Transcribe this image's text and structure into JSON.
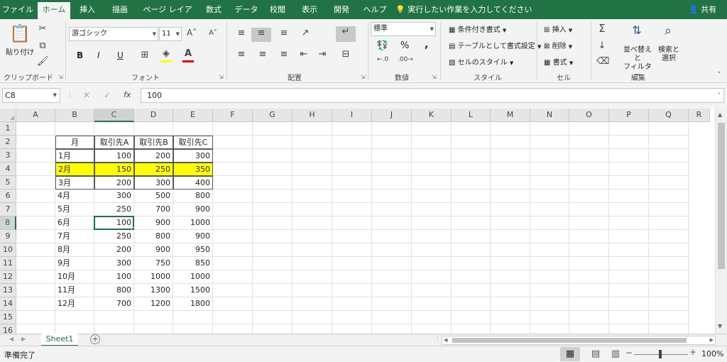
{
  "menu": {
    "tabs": [
      "ファイル",
      "ホーム",
      "挿入",
      "描画",
      "ページ レイアウト",
      "数式",
      "データ",
      "校閲",
      "表示",
      "開発",
      "ヘルプ"
    ],
    "active_tab": "ホーム",
    "tell_me": "実行したい作業を入力してください",
    "share": "共有"
  },
  "ribbon": {
    "clipboard": {
      "paste": "貼り付け",
      "label": "クリップボード"
    },
    "font": {
      "name": "游ゴシック",
      "size": "11",
      "label": "フォント",
      "bold": "B",
      "italic": "I",
      "underline": "U"
    },
    "alignment": {
      "label": "配置"
    },
    "number": {
      "format": "標準",
      "label": "数値",
      "percent": "%",
      "comma": ","
    },
    "styles": {
      "conditional": "条件付き書式",
      "table": "テーブルとして書式設定",
      "cell_styles": "セルのスタイル",
      "label": "スタイル"
    },
    "cells": {
      "insert": "挿入",
      "delete": "削除",
      "format": "書式",
      "label": "セル"
    },
    "editing": {
      "sort_line1": "並べ替えと",
      "sort_line2": "フィルター",
      "find_line1": "検索と",
      "find_line2": "選択",
      "label": "編集"
    },
    "colors": {
      "font_color": "#ff0000",
      "fill_color": "#ffff00"
    }
  },
  "formula_bar": {
    "name_box": "C8",
    "fx": "fx",
    "value": "100"
  },
  "columns": [
    "A",
    "B",
    "C",
    "D",
    "E",
    "F",
    "G",
    "H",
    "I",
    "J",
    "K",
    "L",
    "M",
    "N",
    "O",
    "P",
    "Q",
    "R"
  ],
  "rows": [
    "1",
    "2",
    "3",
    "4",
    "5",
    "6",
    "7",
    "8",
    "9",
    "10",
    "11",
    "12",
    "13",
    "14",
    "15",
    "16"
  ],
  "table": {
    "headers": [
      "月",
      "取引先A",
      "取引先B",
      "取引先C"
    ],
    "data": [
      [
        "1月",
        "100",
        "200",
        "300"
      ],
      [
        "2月",
        "150",
        "250",
        "350"
      ],
      [
        "3月",
        "200",
        "300",
        "400"
      ],
      [
        "4月",
        "300",
        "500",
        "800"
      ],
      [
        "5月",
        "250",
        "700",
        "900"
      ],
      [
        "6月",
        "100",
        "900",
        "1000"
      ],
      [
        "7月",
        "250",
        "800",
        "900"
      ],
      [
        "8月",
        "200",
        "900",
        "950"
      ],
      [
        "9月",
        "300",
        "750",
        "850"
      ],
      [
        "10月",
        "100",
        "1000",
        "1000"
      ],
      [
        "11月",
        "800",
        "1300",
        "1500"
      ],
      [
        "12月",
        "700",
        "1200",
        "1800"
      ]
    ],
    "highlight_color": "#ffff00"
  },
  "selected_cell": "C8",
  "sheet_tab": "Sheet1",
  "status": {
    "ready": "準備完了",
    "zoom": "100%"
  },
  "accent": "#217346"
}
